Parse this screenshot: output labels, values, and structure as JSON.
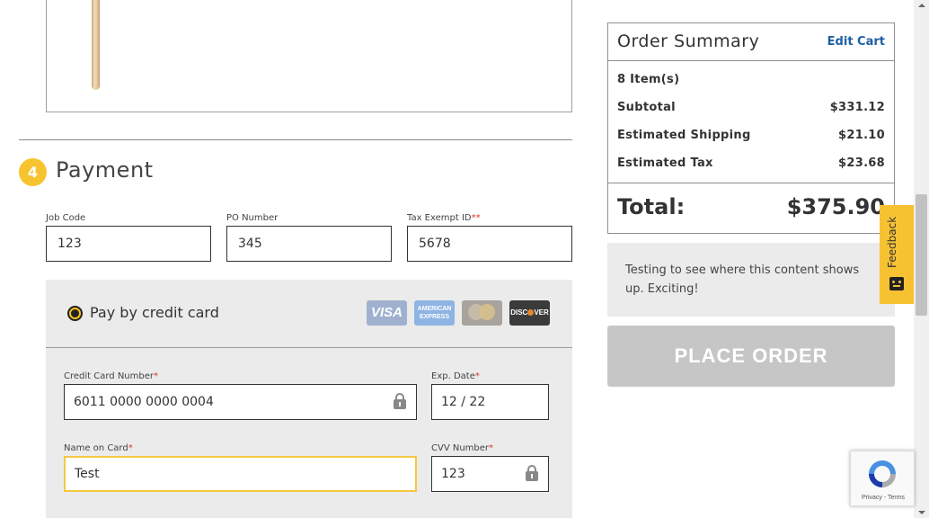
{
  "payment": {
    "step_number": "4",
    "title": "Payment",
    "fields": {
      "job_code": {
        "label": "Job Code",
        "value": "123"
      },
      "po_number": {
        "label": "PO Number",
        "value": "345"
      },
      "tax_exempt": {
        "label": "Tax Exempt ID",
        "marker": "**",
        "value": "5678"
      }
    },
    "method": {
      "label": "Pay by credit card",
      "cards": [
        "visa-icon",
        "amex-icon",
        "mastercard-icon",
        "discover-icon"
      ],
      "card_text": {
        "visa": "VISA",
        "amex": "AMERICAN EXPRESS",
        "discover_1": "DISC",
        "discover_2": "VER"
      }
    },
    "card_fields": {
      "number": {
        "label": "Credit Card Number",
        "value": "6011 0000 0000 0004"
      },
      "exp": {
        "label": "Exp. Date",
        "value": "12 / 22"
      },
      "name": {
        "label": "Name on Card",
        "value": "Test"
      },
      "cvv": {
        "label": "CVV Number",
        "value": "123"
      },
      "required_marker": "*"
    }
  },
  "summary": {
    "title": "Order Summary",
    "edit_cart": "Edit Cart",
    "items": "8 Item(s)",
    "subtotal": {
      "label": "Subtotal",
      "value": "$331.12"
    },
    "shipping": {
      "label": "Estimated Shipping",
      "value": "$21.10"
    },
    "tax": {
      "label": "Estimated Tax",
      "value": "$23.68"
    },
    "total": {
      "label": "Total:",
      "value": "$375.90"
    },
    "note": "Testing to see where this content shows up. Exciting!",
    "place_order": "PLACE ORDER"
  },
  "feedback": {
    "label": "Feedback"
  },
  "recaptcha": {
    "links": "Privacy - Terms"
  },
  "colors": {
    "accent": "#f6c232",
    "link": "#1e5fa3",
    "disabled_button": "#c6c6c6"
  }
}
